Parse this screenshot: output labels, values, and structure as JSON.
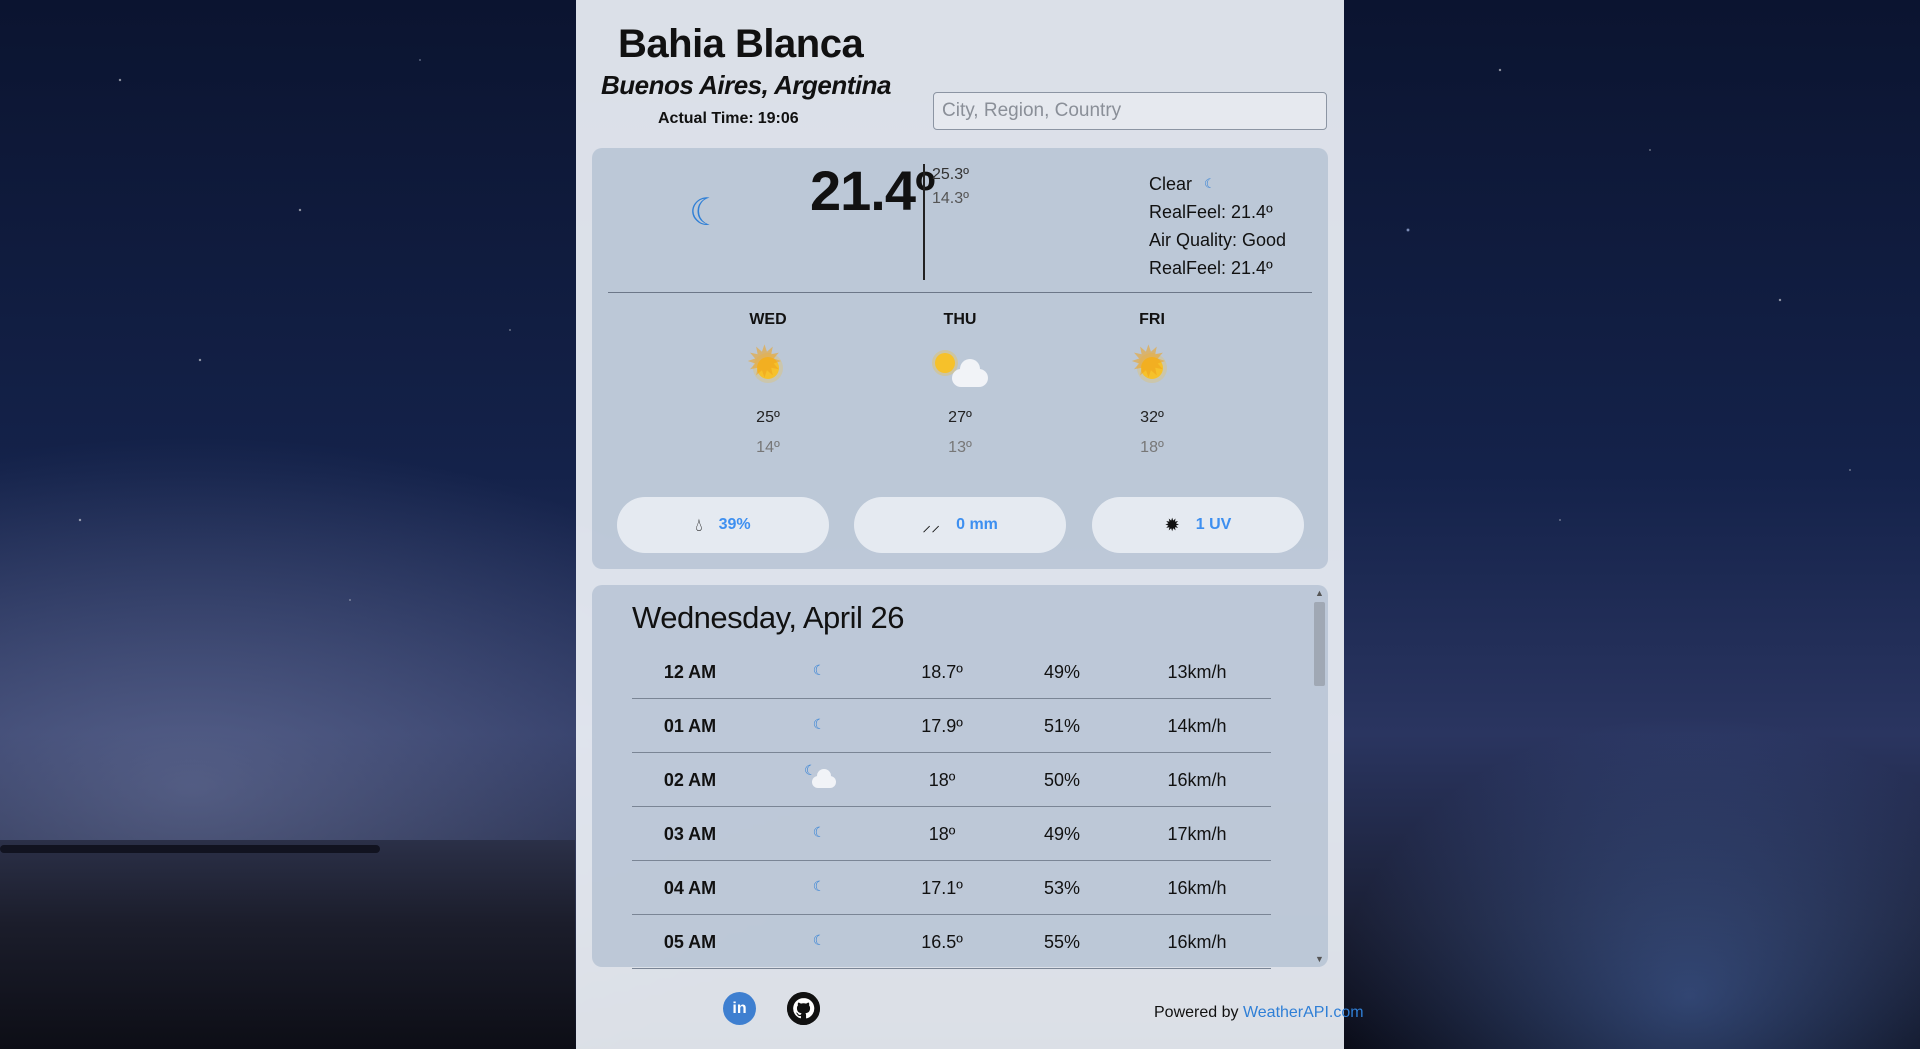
{
  "location": {
    "city": "Bahia Blanca",
    "region": "Buenos Aires, Argentina",
    "time_label": "Actual Time:",
    "time": "19:06"
  },
  "search": {
    "placeholder": "City, Region, Country"
  },
  "current": {
    "icon": "moon-icon",
    "temp": "21.4º",
    "max": "25.3º",
    "min": "14.3º",
    "condition": "Clear",
    "realfeel_1": "RealFeel: 21.4º",
    "air_quality": "Air Quality: Good",
    "realfeel_2": "RealFeel: 21.4º"
  },
  "forecast": [
    {
      "day": "WED",
      "icon": "sun-icon",
      "max": "25º",
      "min": "14º"
    },
    {
      "day": "THU",
      "icon": "sun-cloud-icon",
      "max": "27º",
      "min": "13º"
    },
    {
      "day": "FRI",
      "icon": "sun-icon",
      "max": "32º",
      "min": "18º"
    }
  ],
  "stats": {
    "humidity": "39%",
    "precipitation": "0 mm",
    "uv": "1 UV"
  },
  "hourly": {
    "date": "Wednesday, April 26",
    "rows": [
      {
        "time": "12 AM",
        "icon": "moon-icon",
        "temp": "18.7º",
        "humidity": "49%",
        "wind": "13km/h"
      },
      {
        "time": "01 AM",
        "icon": "moon-icon",
        "temp": "17.9º",
        "humidity": "51%",
        "wind": "14km/h"
      },
      {
        "time": "02 AM",
        "icon": "moon-cloud-icon",
        "temp": "18º",
        "humidity": "50%",
        "wind": "16km/h"
      },
      {
        "time": "03 AM",
        "icon": "moon-icon",
        "temp": "18º",
        "humidity": "49%",
        "wind": "17km/h"
      },
      {
        "time": "04 AM",
        "icon": "moon-icon",
        "temp": "17.1º",
        "humidity": "53%",
        "wind": "16km/h"
      },
      {
        "time": "05 AM",
        "icon": "moon-icon",
        "temp": "16.5º",
        "humidity": "55%",
        "wind": "16km/h"
      }
    ]
  },
  "footer": {
    "powered_label": "Powered by",
    "powered_link": "WeatherAPI.com"
  },
  "colors": {
    "accent": "#3d8ff0",
    "moon": "#2f7fd6",
    "sun": "#f6c12a"
  }
}
